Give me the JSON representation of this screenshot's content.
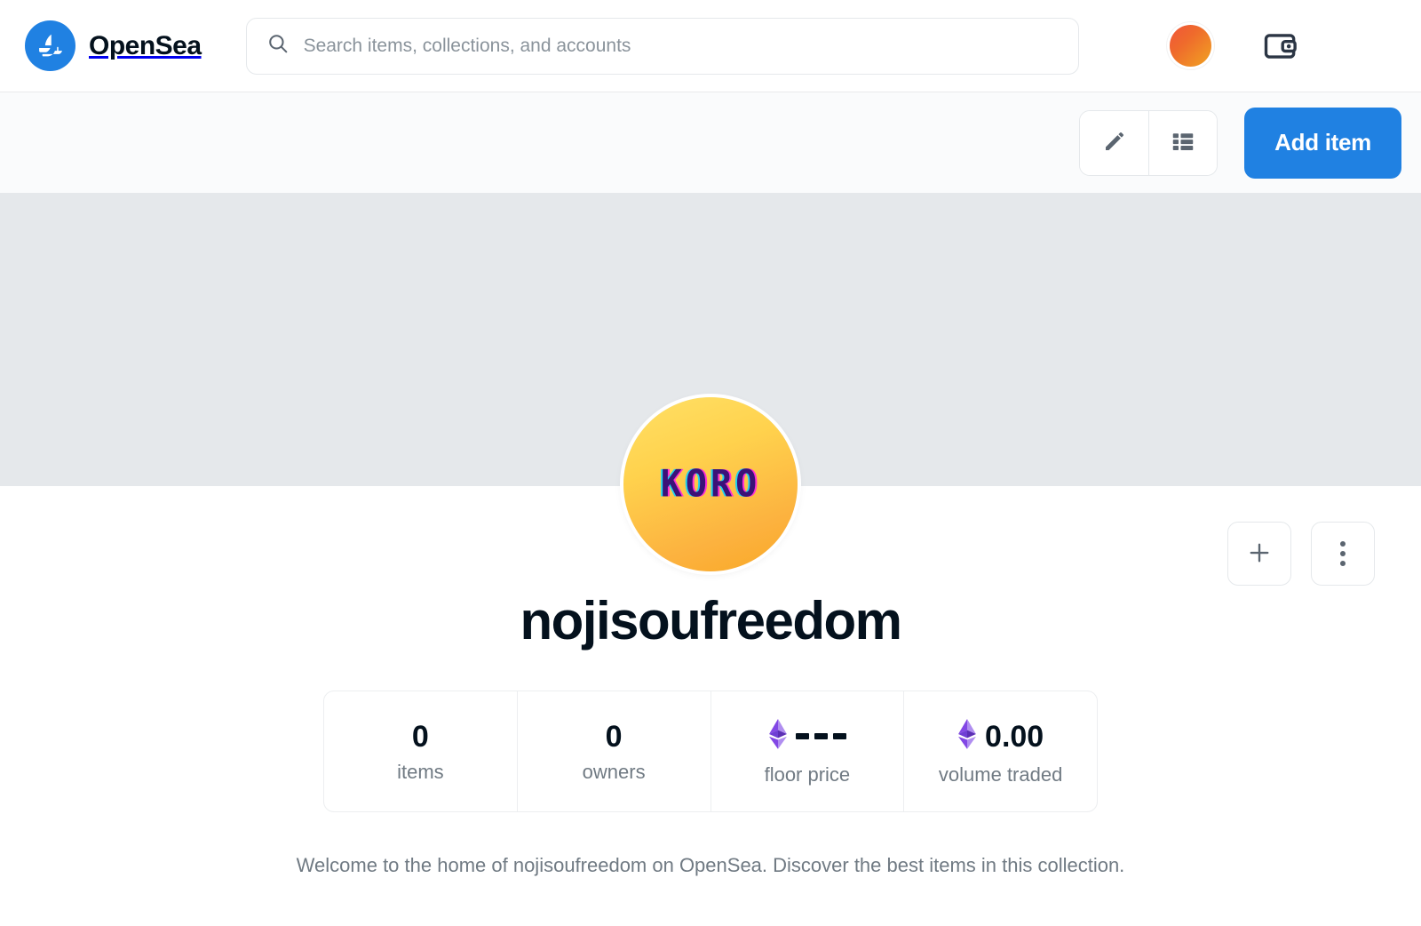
{
  "header": {
    "brand_name": "OpenSea",
    "logo_icon": "opensea-sailboat-logo",
    "search": {
      "placeholder": "Search items, collections, and accounts",
      "value": "",
      "icon": "search-icon"
    },
    "account_avatar_icon": "account-avatar",
    "wallet_icon": "wallet-icon",
    "menu_icon": "hamburger-menu-icon"
  },
  "toolbar": {
    "edit_icon": "pencil-edit-icon",
    "list_view_icon": "list-view-icon",
    "add_item_label": "Add item"
  },
  "banner": {
    "banner_color": "#e5e8eb"
  },
  "profile": {
    "avatar_text": "KORO",
    "avatar_icon": "collection-avatar",
    "title": "nojisoufreedom",
    "description": "Welcome to the home of nojisoufreedom on OpenSea. Discover the best items in this collection.",
    "add_icon": "plus-icon",
    "more_icon": "more-vertical-icon"
  },
  "stats": [
    {
      "value": "0",
      "label": "items",
      "currency_icon": ""
    },
    {
      "value": "0",
      "label": "owners",
      "currency_icon": ""
    },
    {
      "value": "---",
      "label": "floor price",
      "currency_icon": "ethereum-icon"
    },
    {
      "value": "0.00",
      "label": "volume traded",
      "currency_icon": "ethereum-icon"
    }
  ],
  "colors": {
    "accent_blue": "#2081e2",
    "banner_gray": "#e5e8eb",
    "text_dark": "#04111d",
    "text_muted": "#707a83",
    "eth_purple": "#8247e5"
  }
}
